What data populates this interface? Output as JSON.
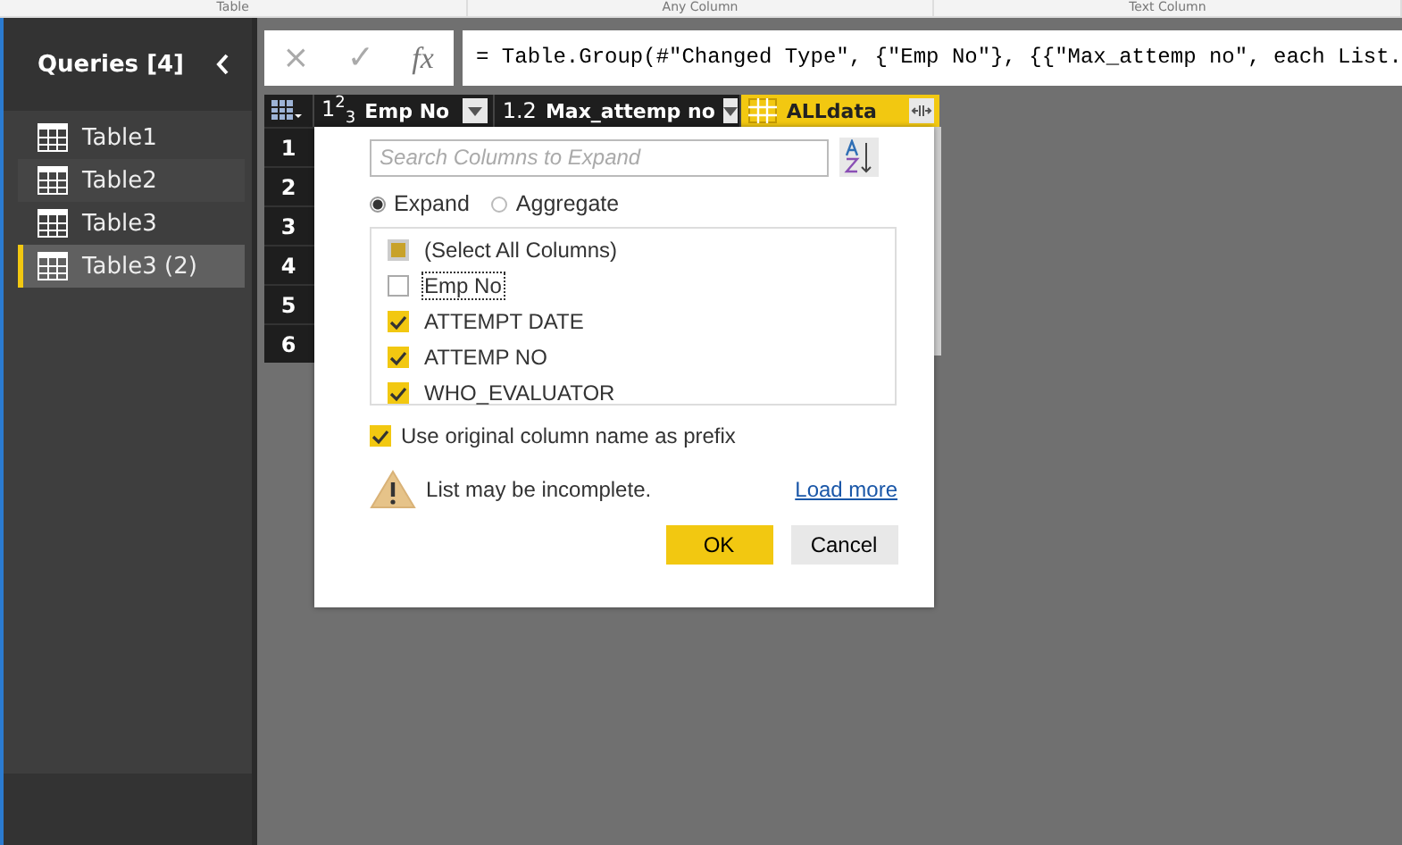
{
  "ribbon_groups": [
    "Table",
    "Any Column",
    "Text Column"
  ],
  "sidebar": {
    "title": "Queries [4]",
    "items": [
      {
        "label": "Table1",
        "selected": false
      },
      {
        "label": "Table2",
        "selected": false
      },
      {
        "label": "Table3",
        "selected": false
      },
      {
        "label": "Table3 (2)",
        "selected": true
      }
    ]
  },
  "formula_bar": {
    "icons": [
      "×",
      "✓"
    ],
    "fx": "fx",
    "formula": "= Table.Group(#\"Changed Type\", {\"Emp No\"}, {{\"Max_attemp no\", each List."
  },
  "table": {
    "columns": [
      {
        "kind": "number",
        "type_label": "1$^{2}$$_{3}$",
        "name": "Emp No",
        "selected": false
      },
      {
        "kind": "number",
        "type_label": "1.2",
        "name": "Max_attemp no",
        "selected": false
      },
      {
        "kind": "table",
        "name": "ALLdata",
        "selected": true
      }
    ],
    "row_numbers": [
      "1",
      "2",
      "3",
      "4",
      "5",
      "6"
    ]
  },
  "expand_popup": {
    "search": {
      "placeholder": "Search Columns to Expand"
    },
    "modes": [
      {
        "label": "Expand",
        "selected": true
      },
      {
        "label": "Aggregate",
        "selected": false
      }
    ],
    "columns": [
      {
        "label": "(Select All Columns)",
        "checked": false,
        "indeterminate": true,
        "focused": false
      },
      {
        "label": "Emp No",
        "checked": false,
        "indeterminate": false,
        "focused": true
      },
      {
        "label": "ATTEMPT DATE",
        "checked": true,
        "indeterminate": false,
        "focused": false
      },
      {
        "label": "ATTEMP NO",
        "checked": true,
        "indeterminate": false,
        "focused": false
      },
      {
        "label": "WHO_EVALUATOR",
        "checked": true,
        "indeterminate": false,
        "focused": false
      }
    ],
    "prefix": {
      "label": "Use original column name as prefix",
      "checked": true
    },
    "warning": "List may be incomplete.",
    "load_more": "Load more",
    "buttons": [
      {
        "label": "OK",
        "kind": "primary"
      },
      {
        "label": "Cancel",
        "kind": "secondary"
      }
    ]
  }
}
